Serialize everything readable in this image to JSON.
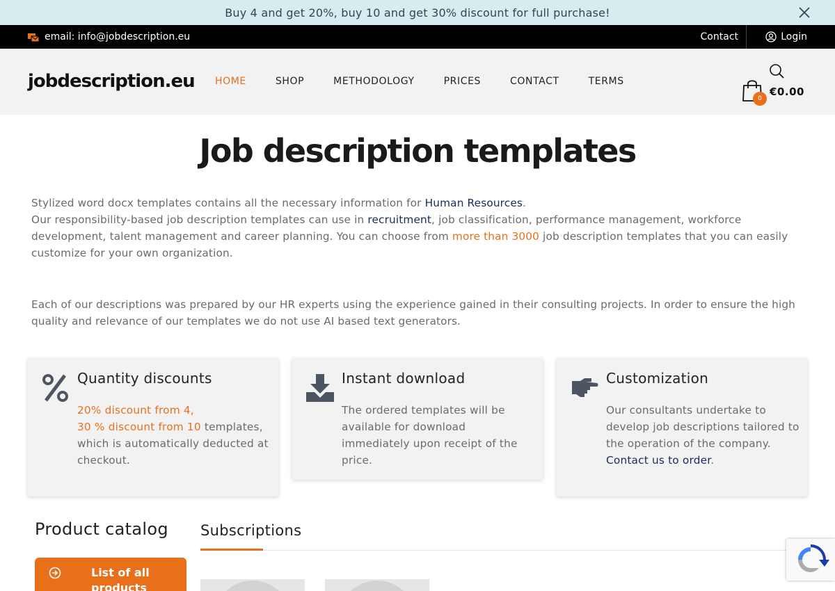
{
  "promo": {
    "text": "Buy 4 and get 20%, buy 10 and get 30% discount for full purchase!"
  },
  "topbar": {
    "email": "email: info@jobdescription.eu",
    "contact": "Contact",
    "login": "Login"
  },
  "header": {
    "logo": "jobdescription.eu",
    "nav": [
      "HOME",
      "SHOP",
      "METHODOLOGY",
      "PRICES",
      "CONTACT",
      "TERMS"
    ],
    "cart_count": "0",
    "cart_total": "€0.00"
  },
  "main": {
    "title": "Job description templates",
    "intro": {
      "l1_a": "Stylized word docx templates contains all the necessary information for ",
      "l1_link": "Human Resources",
      "l1_b": ".",
      "l2_a": "Our responsibility-based job description templates can use in ",
      "l2_link": "recruitment",
      "l2_b": ", job classification, performance management, workforce development, talent management and career planning. You can choose from ",
      "l2_link2": "more than 3000",
      "l2_c": " job description templates that you can easily customize for your own organization."
    },
    "para2": "Each of our descriptions was prepared by our HR experts using the experience gained in their consulting projects. In order to ensure the high quality and relevance of our templates we do not use AI based text generators."
  },
  "cards": [
    {
      "title": "Quantity discounts",
      "hl1": "20% discount from 4,",
      "hl2": "30 % discount from 10",
      "text": " templates, which is automatically deducted at checkout."
    },
    {
      "title": "Instant download",
      "text": "The ordered templates will be available for download  immediately upon receipt of the price."
    },
    {
      "title": "Customization",
      "text": "Our consultants undertake to develop job descriptions tailored to the operation of the company. ",
      "link": "Contact us to order",
      "end": "."
    }
  ],
  "catalog": {
    "title": "Product catalog",
    "button": "List of all products"
  },
  "subscriptions": {
    "title": "Subscriptions"
  },
  "colors": {
    "accent": "#e8701a",
    "navy": "#1b2a5c",
    "promo_bg": "#d6ecef",
    "header_bg": "#f2f2f2"
  }
}
